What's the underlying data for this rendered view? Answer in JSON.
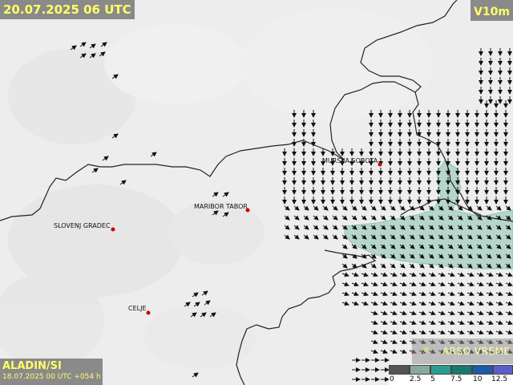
{
  "header": {
    "valid_time": "20.07.2025 06 UTC",
    "parameter": "V10m"
  },
  "model": {
    "name": "ALADIN/SI",
    "run": "18.07.2025 00 UTC +054 h"
  },
  "brand": {
    "icon": "sun-icon",
    "name": "ARSO VREME"
  },
  "legend": {
    "ticks": [
      "0",
      "2.5",
      "5",
      "7.5",
      "10",
      "12.5"
    ],
    "colors": [
      "#555555",
      "#88aa99",
      "#2a9d8f",
      "#1a7a6a",
      "#1e5aa8",
      "#5a5fc8"
    ]
  },
  "cities": [
    {
      "name": "MURSKA SOBOTA"
    },
    {
      "name": "MARIBOR TABOR"
    },
    {
      "name": "SLOVENJ GRADEC"
    },
    {
      "name": "CELJE"
    }
  ],
  "colors": {
    "background": "#eeeeee",
    "border_line": "#222222",
    "city_dot": "#cc0000",
    "wind_shade": "#7fbfa8"
  }
}
